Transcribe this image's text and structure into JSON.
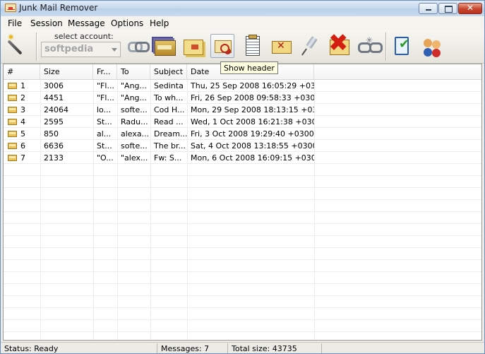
{
  "window": {
    "title": "Junk Mail Remover"
  },
  "menu": [
    "File",
    "Session",
    "Message",
    "Options",
    "Help"
  ],
  "toolbar": {
    "account_label": "select account:",
    "account_value": "softpedia",
    "tooltip": "Show header",
    "icons": [
      "magic-wand-icon",
      "connect-link-icon",
      "message-stack-icon",
      "message-cards-icon",
      "envelope-search-icon",
      "document-icon",
      "envelope-delete-icon",
      "pin-icon",
      "no-delete-icon",
      "disconnect-icon",
      "checklist-icon",
      "users-icon"
    ]
  },
  "list": {
    "columns": [
      "#",
      "Size",
      "Fr...",
      "To",
      "Subject",
      "Date"
    ],
    "rows": [
      {
        "num": "1",
        "size": "3006",
        "from": "\"Fl...",
        "to": "\"Ang...",
        "subject": "Sedinta",
        "date": "Thu, 25 Sep 2008 16:05:29 +0300"
      },
      {
        "num": "2",
        "size": "4451",
        "from": "\"Fl...",
        "to": "\"Ang...",
        "subject": "To wh...",
        "date": "Fri, 26 Sep 2008 09:58:33 +0300"
      },
      {
        "num": "3",
        "size": "24064",
        "from": "lo...",
        "to": "softe...",
        "subject": "Cod H...",
        "date": "Mon, 29 Sep 2008 18:13:15 +0300"
      },
      {
        "num": "4",
        "size": "2595",
        "from": "St...",
        "to": "Radu...",
        "subject": "Read ...",
        "date": "Wed, 1 Oct 2008 16:21:38 +0300"
      },
      {
        "num": "5",
        "size": "850",
        "from": "al...",
        "to": "alexa...",
        "subject": "Dream...",
        "date": "Fri, 3 Oct 2008 19:29:40 +0300"
      },
      {
        "num": "6",
        "size": "6636",
        "from": "St...",
        "to": "softe...",
        "subject": "The br...",
        "date": "Sat, 4 Oct 2008 13:18:55 +0300"
      },
      {
        "num": "7",
        "size": "2133",
        "from": "\"O...",
        "to": "\"alex...",
        "subject": "Fw: S...",
        "date": "Mon, 6 Oct 2008 16:09:15 +0300"
      }
    ]
  },
  "status": {
    "status": "Status: Ready",
    "messages": "Messages: 7",
    "total_size": "Total size: 43735"
  },
  "colors": {
    "titlebar": "#c7d9ee",
    "close_button": "#c7442b",
    "tooltip_bg": "#ffffe1",
    "envelope": "#e8c35a"
  }
}
